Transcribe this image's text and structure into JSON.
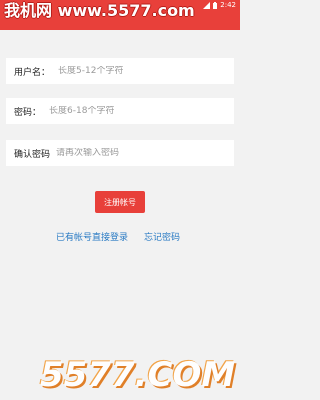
{
  "status_bar": {
    "time": "2:42",
    "icons": [
      "signal-icon",
      "battery-icon"
    ]
  },
  "watermark_top": "我机网 www.5577.com",
  "form": {
    "username": {
      "label": "用户名：",
      "placeholder": "长度5-12个字符",
      "value": ""
    },
    "password": {
      "label": "密码：",
      "placeholder": "长度6-18个字符",
      "value": ""
    },
    "confirm_password": {
      "label": "确认密码",
      "placeholder": "请再次输入密码",
      "value": ""
    }
  },
  "register_button": "注册帐号",
  "links": {
    "login": "已有帐号直接登录",
    "forgot": "忘记密码"
  },
  "watermark_bottom": "5577.COM",
  "colors": {
    "accent": "#e8403a",
    "link": "#2a7bc4",
    "background": "#f2f2f2"
  }
}
